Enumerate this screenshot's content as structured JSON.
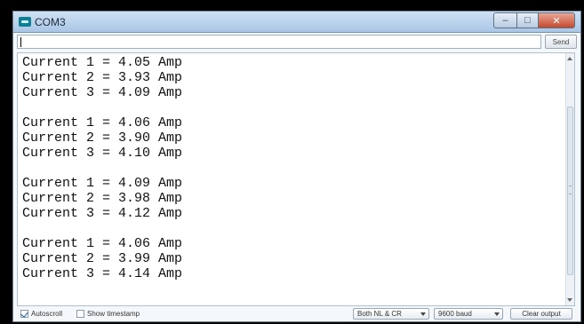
{
  "window": {
    "title": "COM3"
  },
  "input": {
    "value": "",
    "send_label": "Send"
  },
  "output": {
    "lines": [
      "Current 1 = 4.05 Amp",
      "Current 2 = 3.93 Amp",
      "Current 3 = 4.09 Amp",
      "",
      "Current 1 = 4.06 Amp",
      "Current 2 = 3.90 Amp",
      "Current 3 = 4.10 Amp",
      "",
      "Current 1 = 4.09 Amp",
      "Current 2 = 3.98 Amp",
      "Current 3 = 4.12 Amp",
      "",
      "Current 1 = 4.06 Amp",
      "Current 2 = 3.99 Amp",
      "Current 3 = 4.14 Amp"
    ]
  },
  "status": {
    "autoscroll_label": "Autoscroll",
    "autoscroll_checked": true,
    "timestamp_label": "Show timestamp",
    "timestamp_checked": false,
    "line_ending": "Both NL & CR",
    "baud": "9600 baud",
    "clear_label": "Clear output"
  },
  "icons": {
    "app": "serial-monitor-icon",
    "minimize": "minimize-icon",
    "maximize": "maximize-icon",
    "close": "close-icon"
  }
}
